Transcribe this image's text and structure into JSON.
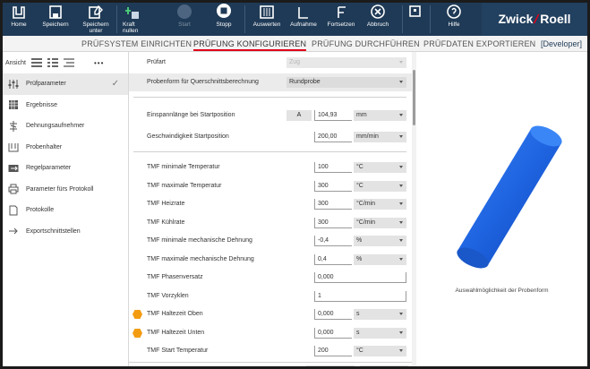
{
  "toolbar": {
    "buttons": [
      {
        "label": "Home",
        "icon": "home-icon"
      },
      {
        "label": "Speichern",
        "icon": "save-icon"
      },
      {
        "label": "Speichern unter",
        "icon": "save-as-icon"
      },
      {
        "label": "Kraft nullen",
        "icon": "zero-force-icon"
      },
      {
        "label": "Start",
        "icon": "play-icon",
        "disabled": true
      },
      {
        "label": "Stopp",
        "icon": "stop-icon"
      },
      {
        "label": "Auswerten",
        "icon": "evaluate-icon"
      },
      {
        "label": "Aufnahme",
        "icon": "record-icon"
      },
      {
        "label": "Fortsetzen",
        "icon": "continue-icon"
      },
      {
        "label": "Abbruch",
        "icon": "abort-icon"
      },
      {
        "label": "Hilfe",
        "icon": "help-icon"
      }
    ],
    "brand_left": "Zwick",
    "brand_right": "Roell",
    "brand_slash_color": "#e2001a",
    "background": "#1f3a56"
  },
  "tabs": {
    "items": [
      "PRÜFSYSTEM EINRICHTEN",
      "PRÜFUNG KONFIGURIEREN",
      "PRÜFUNG DURCHFÜHREN",
      "PRÜFDATEN EXPORTIEREN"
    ],
    "active_index": 1,
    "user": "[Developer]"
  },
  "sidebar": {
    "view_label": "Ansicht",
    "more": "•••",
    "items": [
      {
        "label": "Prüfparameter",
        "icon": "parameters-icon",
        "active": true,
        "check": "✓"
      },
      {
        "label": "Ergebnisse",
        "icon": "results-grid-icon"
      },
      {
        "label": "Dehnungsaufnehmer",
        "icon": "extensometer-icon"
      },
      {
        "label": "Probenhalter",
        "icon": "specimen-holder-icon"
      },
      {
        "label": "Regelparameter",
        "icon": "control-parameters-icon"
      },
      {
        "label": "Parameter fürs Protokoll",
        "icon": "printer-icon"
      },
      {
        "label": "Protokolle",
        "icon": "document-icon"
      },
      {
        "label": "Exportschnittstellen",
        "icon": "export-arrow-icon"
      }
    ]
  },
  "form": {
    "rows": [
      {
        "label": "Prüfart",
        "value": "Zug",
        "unit": "",
        "type": "select-disabled"
      },
      {
        "label": "Probenform für Querschnittsberechnung",
        "value": "Rundprobe",
        "type": "select"
      },
      {
        "label": "Einspannlänge bei Startposition",
        "tag": "A",
        "value": "104,93",
        "unit": "mm"
      },
      {
        "label": "Geschwindigkeit Startposition",
        "value": "200,00",
        "unit": "mm/min"
      },
      {
        "label": "TMF minimale Temperatur",
        "value": "100",
        "unit": "°C"
      },
      {
        "label": "TMF maximale Temperatur",
        "value": "300",
        "unit": "°C"
      },
      {
        "label": "TMF Heizrate",
        "value": "300",
        "unit": "°C/min"
      },
      {
        "label": "TMF Kühlrate",
        "value": "300",
        "unit": "°C/min"
      },
      {
        "label": "TMF minimale mechanische Dehnung",
        "value": "-0,4",
        "unit": "%"
      },
      {
        "label": "TMF maximale mechanische Dehnung",
        "value": "0,4",
        "unit": "%"
      },
      {
        "label": "TMF Phasenversatz",
        "value": "0,000",
        "unit": ""
      },
      {
        "label": "TMF Vorzyklen",
        "value": "1",
        "unit": ""
      },
      {
        "label": "TMF Haltezeit Oben",
        "value": "0,000",
        "unit": "s",
        "warning": true
      },
      {
        "label": "TMF Haltezeit Unten",
        "value": "0,000",
        "unit": "s",
        "warning": true
      },
      {
        "label": "TMF Start Temperatur",
        "value": "200",
        "unit": "°C"
      }
    ]
  },
  "preview": {
    "caption": "Auswahlmöglichkeit der Probenform",
    "shape_color": "#1e63e0"
  }
}
